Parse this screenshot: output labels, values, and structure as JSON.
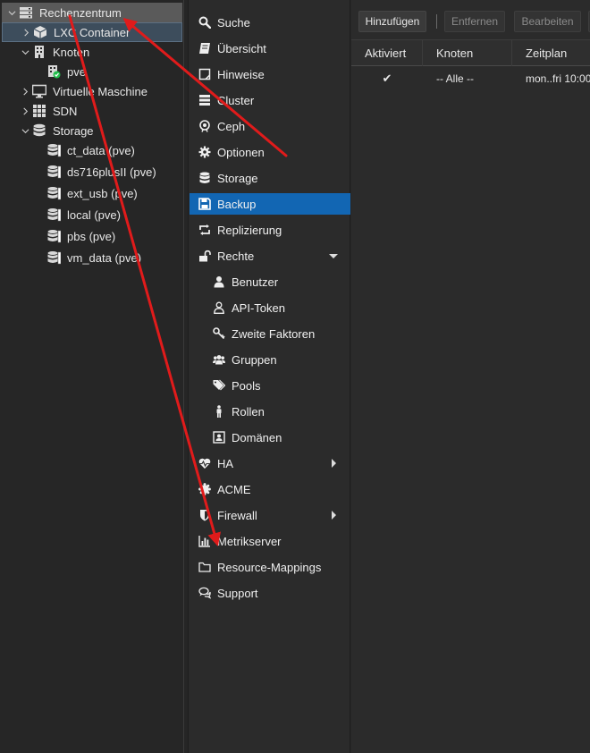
{
  "tree": {
    "items": [
      {
        "label": "Rechenzentrum"
      },
      {
        "label": "LXC Container"
      },
      {
        "label": "Knoten"
      },
      {
        "label": "pve"
      },
      {
        "label": "Virtuelle Maschine"
      },
      {
        "label": "SDN"
      },
      {
        "label": "Storage"
      },
      {
        "label": "ct_data (pve)"
      },
      {
        "label": "ds716plusII (pve)"
      },
      {
        "label": "ext_usb (pve)"
      },
      {
        "label": "local (pve)"
      },
      {
        "label": "pbs (pve)"
      },
      {
        "label": "vm_data (pve)"
      }
    ]
  },
  "nav": {
    "items": [
      {
        "label": "Suche",
        "icon": "search-icon"
      },
      {
        "label": "Übersicht",
        "icon": "book-icon"
      },
      {
        "label": "Hinweise",
        "icon": "note-icon"
      },
      {
        "label": "Cluster",
        "icon": "server-icon"
      },
      {
        "label": "Ceph",
        "icon": "ceph-icon"
      },
      {
        "label": "Optionen",
        "icon": "gear-icon"
      },
      {
        "label": "Storage",
        "icon": "database-icon"
      },
      {
        "label": "Backup",
        "icon": "floppy-icon"
      },
      {
        "label": "Replizierung",
        "icon": "retweet-icon"
      },
      {
        "label": "Rechte",
        "icon": "unlock-icon"
      },
      {
        "label": "Benutzer",
        "icon": "user-icon"
      },
      {
        "label": "API-Token",
        "icon": "user-outline-icon"
      },
      {
        "label": "Zweite Faktoren",
        "icon": "key-icon"
      },
      {
        "label": "Gruppen",
        "icon": "users-icon"
      },
      {
        "label": "Pools",
        "icon": "tags-icon"
      },
      {
        "label": "Rollen",
        "icon": "male-icon"
      },
      {
        "label": "Domänen",
        "icon": "id-badge-icon"
      },
      {
        "label": "HA",
        "icon": "heartbeat-icon"
      },
      {
        "label": "ACME",
        "icon": "certificate-icon"
      },
      {
        "label": "Firewall",
        "icon": "shield-icon"
      },
      {
        "label": "Metrikserver",
        "icon": "bar-chart-icon"
      },
      {
        "label": "Resource-Mappings",
        "icon": "folder-icon"
      },
      {
        "label": "Support",
        "icon": "comments-icon"
      }
    ]
  },
  "toolbar": {
    "add_label": "Hinzufügen",
    "remove_label": "Entfernen",
    "edit_label": "Bearbeiten"
  },
  "grid": {
    "columns": [
      "Aktiviert",
      "Knoten",
      "Zeitplan"
    ],
    "rows": [
      {
        "enabled": "✔",
        "node": "-- Alle --",
        "schedule": "mon..fri 10:00"
      }
    ]
  },
  "colors": {
    "active_nav": "#1266b3",
    "annotation_arrow": "#e01b1b",
    "status_ok": "#21bf4b"
  }
}
